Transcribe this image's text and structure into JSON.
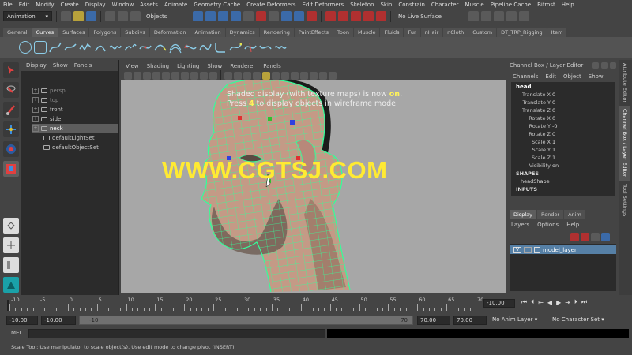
{
  "menu": [
    "File",
    "Edit",
    "Modify",
    "Create",
    "Display",
    "Window",
    "Assets",
    "Animate",
    "Geometry Cache",
    "Create Deformers",
    "Edit Deformers",
    "Skeleton",
    "Skin",
    "Constrain",
    "Character",
    "Muscle",
    "Pipeline Cache",
    "Bifrost",
    "Help"
  ],
  "status": {
    "menuset": "Animation",
    "selection_mode": "Objects",
    "live_surface": "No Live Surface"
  },
  "shelf_tabs": [
    "General",
    "Curves",
    "Surfaces",
    "Polygons",
    "Subdivs",
    "Deformation",
    "Animation",
    "Dynamics",
    "Rendering",
    "PaintEffects",
    "Toon",
    "Muscle",
    "Fluids",
    "Fur",
    "nHair",
    "nCloth",
    "Custom",
    "DT_TRP_Rigging",
    "Item"
  ],
  "active_shelf_tab": "Curves",
  "outliner": {
    "menu": [
      "Display",
      "Show",
      "Panels"
    ],
    "items": [
      {
        "label": "persp",
        "dim": true,
        "selected": false,
        "expander": "+"
      },
      {
        "label": "top",
        "dim": true,
        "selected": false,
        "expander": "+"
      },
      {
        "label": "front",
        "dim": false,
        "selected": false,
        "expander": "+"
      },
      {
        "label": "side",
        "dim": false,
        "selected": false,
        "expander": "+"
      },
      {
        "label": "neck",
        "dim": false,
        "selected": true,
        "expander": "+"
      },
      {
        "label": "defaultLightSet",
        "dim": false,
        "selected": false,
        "expander": ""
      },
      {
        "label": "defaultObjectSet",
        "dim": false,
        "selected": false,
        "expander": ""
      }
    ]
  },
  "viewport": {
    "menu": [
      "View",
      "Shading",
      "Lighting",
      "Show",
      "Renderer",
      "Panels"
    ],
    "message_line1_pre": "Shaded display (with texture maps) is now ",
    "message_line1_hl": "on",
    "message_line1_post": ".",
    "message_line2_pre": "Press ",
    "message_line2_hl": "4",
    "message_line2_post": " to display objects in wireframe mode.",
    "watermark": "WWW.CGTSJ.COM"
  },
  "channel_box": {
    "title": "Channel Box / Layer Editor",
    "menu": [
      "Channels",
      "Edit",
      "Object",
      "Show"
    ],
    "object": "head",
    "attributes": [
      {
        "name": "Translate X",
        "value": "0"
      },
      {
        "name": "Translate Y",
        "value": "0"
      },
      {
        "name": "Translate Z",
        "value": "0"
      },
      {
        "name": "Rotate X",
        "value": "0"
      },
      {
        "name": "Rotate Y",
        "value": "-0"
      },
      {
        "name": "Rotate Z",
        "value": "0"
      },
      {
        "name": "Scale X",
        "value": "1"
      },
      {
        "name": "Scale Y",
        "value": "1"
      },
      {
        "name": "Scale Z",
        "value": "1"
      },
      {
        "name": "Visibility",
        "value": "on"
      }
    ],
    "shapes_label": "SHAPES",
    "shape": "headShape",
    "inputs_label": "INPUTS"
  },
  "side_tabs": [
    "Attribute Editor",
    "Channel Box / Layer Editor",
    "Tool Settings"
  ],
  "layer_editor": {
    "tabs": [
      "Display",
      "Render",
      "Anim"
    ],
    "menu": [
      "Layers",
      "Options",
      "Help"
    ],
    "layer_vis": "V",
    "layer_name": "model_layer"
  },
  "timeline": {
    "ticks": [
      "-10",
      "-5",
      "0",
      "5",
      "10",
      "15",
      "20",
      "25",
      "30",
      "35",
      "40",
      "45",
      "50",
      "55",
      "60",
      "65",
      "70"
    ],
    "current_frame": "-10.00"
  },
  "range": {
    "start": "-10.00",
    "playback_start": "-10.00",
    "bar_start": "-10",
    "bar_end": "70",
    "playback_end": "70.00",
    "end": "70.00",
    "anim_layer": "No Anim Layer",
    "character_set": "No Character Set"
  },
  "mel_label": "MEL",
  "help_line": "Scale Tool: Use manipulator to scale object(s). Use edit mode to change pivot (INSERT).",
  "colors": {
    "accent_cyan": "#8ccde8",
    "watermark": "#ffea33",
    "wire_green": "#33ff99",
    "layer_selected": "#5680a6"
  }
}
